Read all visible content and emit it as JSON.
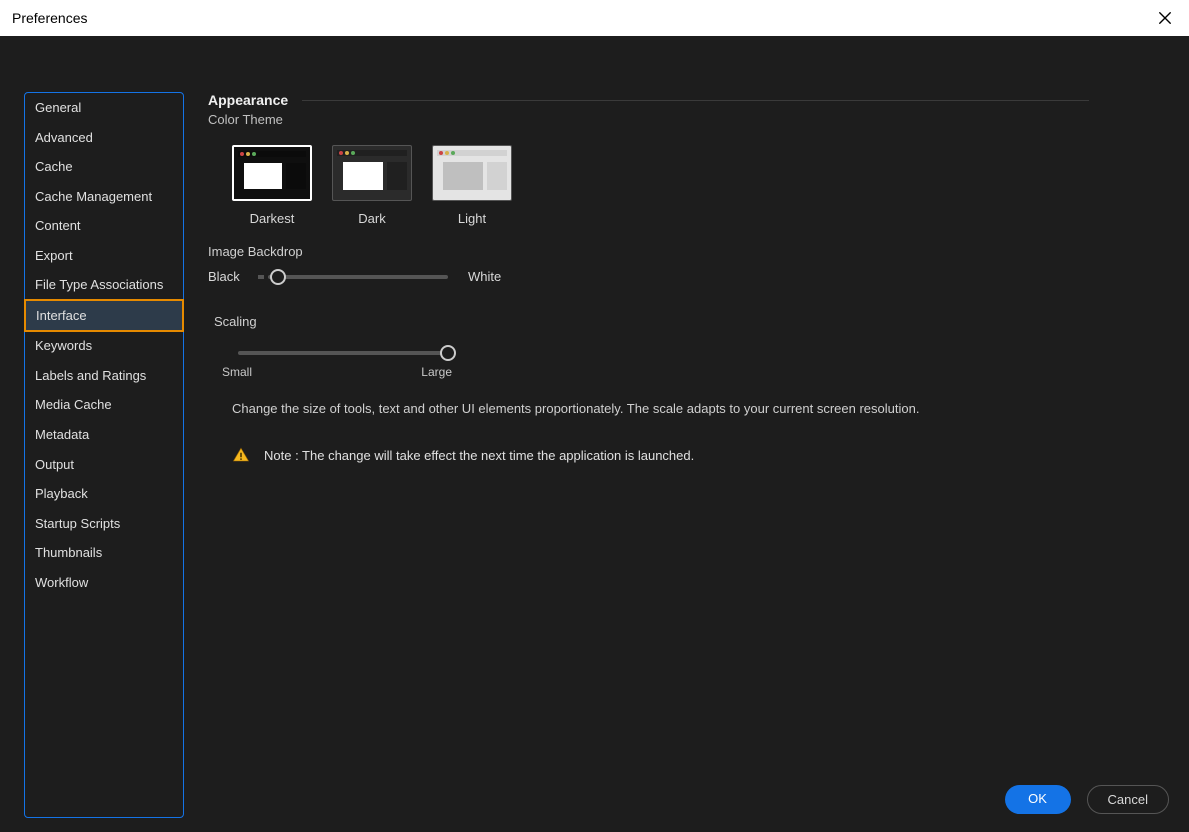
{
  "window": {
    "title": "Preferences"
  },
  "sidebar": {
    "items": [
      {
        "label": "General"
      },
      {
        "label": "Advanced"
      },
      {
        "label": "Cache"
      },
      {
        "label": "Cache Management"
      },
      {
        "label": "Content"
      },
      {
        "label": "Export"
      },
      {
        "label": "File Type Associations"
      },
      {
        "label": "Interface",
        "selected": true
      },
      {
        "label": "Keywords"
      },
      {
        "label": "Labels and Ratings"
      },
      {
        "label": "Media Cache"
      },
      {
        "label": "Metadata"
      },
      {
        "label": "Output"
      },
      {
        "label": "Playback"
      },
      {
        "label": "Startup Scripts"
      },
      {
        "label": "Thumbnails"
      },
      {
        "label": "Workflow"
      }
    ]
  },
  "appearance": {
    "heading": "Appearance",
    "colorThemeLabel": "Color Theme",
    "themes": {
      "darkest": "Darkest",
      "dark": "Dark",
      "light": "Light",
      "selected": "darkest"
    },
    "backdrop": {
      "label": "Image Backdrop",
      "minLabel": "Black",
      "maxLabel": "White"
    }
  },
  "scaling": {
    "heading": "Scaling",
    "minLabel": "Small",
    "maxLabel": "Large",
    "description": "Change the size of tools, text and other UI elements proportionately. The scale adapts to your current screen resolution.",
    "note": "Note : The change will take effect the next time the application is launched."
  },
  "buttons": {
    "ok": "OK",
    "cancel": "Cancel"
  }
}
